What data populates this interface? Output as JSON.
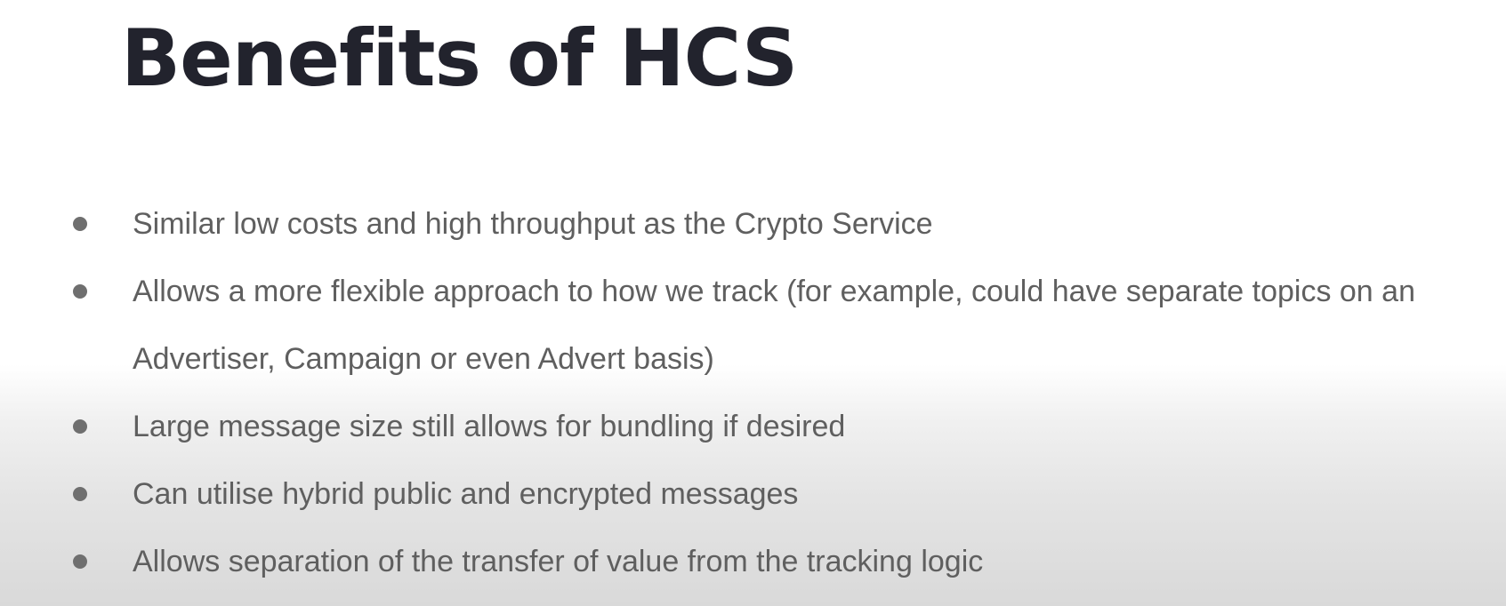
{
  "slide": {
    "title": "Benefits of HCS",
    "bullets": [
      {
        "text": "Similar low costs and high throughput as the Crypto Service"
      },
      {
        "text": "Allows a more flexible approach to how we track (for example, could have separate topics on an Advertiser, Campaign or even Advert basis)"
      },
      {
        "text": "Large message size still allows for bundling if desired"
      },
      {
        "text": "Can utilise hybrid public and encrypted messages"
      },
      {
        "text": "Allows separation of the transfer of value from the tracking logic"
      }
    ]
  },
  "colors": {
    "title": "#22232d",
    "body_text": "#5f5f5f",
    "bullet": "#6f6f6f",
    "background_top": "#ffffff",
    "background_bottom": "#d9d9d9"
  },
  "icons": {
    "bullet": "bullet-dot-icon"
  }
}
